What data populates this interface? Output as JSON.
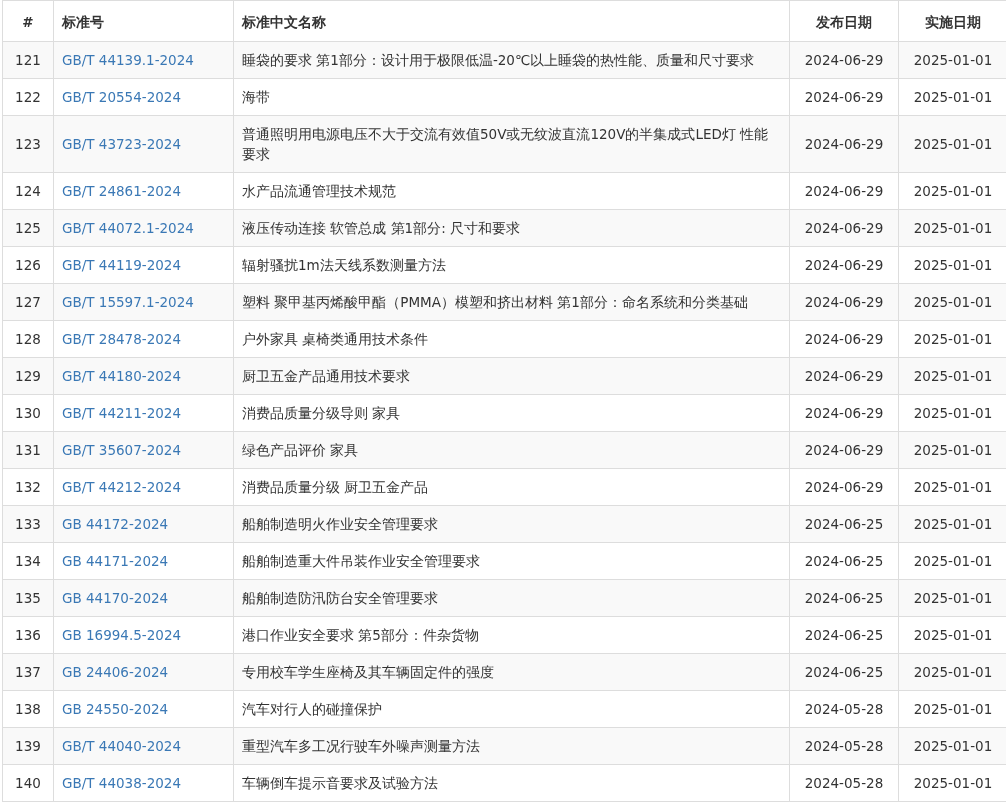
{
  "table": {
    "columns": [
      "#",
      "标准号",
      "标准中文名称",
      "发布日期",
      "实施日期"
    ],
    "rows": [
      {
        "index": "121",
        "code": "GB/T 44139.1-2024",
        "name": "睡袋的要求 第1部分：设计用于极限低温-20℃以上睡袋的热性能、质量和尺寸要求",
        "published": "2024-06-29",
        "effective": "2025-01-01"
      },
      {
        "index": "122",
        "code": "GB/T 20554-2024",
        "name": "海带",
        "published": "2024-06-29",
        "effective": "2025-01-01"
      },
      {
        "index": "123",
        "code": "GB/T 43723-2024",
        "name": "普通照明用电源电压不大于交流有效值50V或无纹波直流120V的半集成式LED灯 性能要求",
        "published": "2024-06-29",
        "effective": "2025-01-01"
      },
      {
        "index": "124",
        "code": "GB/T 24861-2024",
        "name": "水产品流通管理技术规范",
        "published": "2024-06-29",
        "effective": "2025-01-01"
      },
      {
        "index": "125",
        "code": "GB/T 44072.1-2024",
        "name": "液压传动连接 软管总成 第1部分: 尺寸和要求",
        "published": "2024-06-29",
        "effective": "2025-01-01"
      },
      {
        "index": "126",
        "code": "GB/T 44119-2024",
        "name": "辐射骚扰1m法天线系数测量方法",
        "published": "2024-06-29",
        "effective": "2025-01-01"
      },
      {
        "index": "127",
        "code": "GB/T 15597.1-2024",
        "name": "塑料 聚甲基丙烯酸甲酯（PMMA）模塑和挤出材料 第1部分：命名系统和分类基础",
        "published": "2024-06-29",
        "effective": "2025-01-01"
      },
      {
        "index": "128",
        "code": "GB/T 28478-2024",
        "name": "户外家具 桌椅类通用技术条件",
        "published": "2024-06-29",
        "effective": "2025-01-01"
      },
      {
        "index": "129",
        "code": "GB/T 44180-2024",
        "name": "厨卫五金产品通用技术要求",
        "published": "2024-06-29",
        "effective": "2025-01-01"
      },
      {
        "index": "130",
        "code": "GB/T 44211-2024",
        "name": "消费品质量分级导则 家具",
        "published": "2024-06-29",
        "effective": "2025-01-01"
      },
      {
        "index": "131",
        "code": "GB/T 35607-2024",
        "name": "绿色产品评价 家具",
        "published": "2024-06-29",
        "effective": "2025-01-01"
      },
      {
        "index": "132",
        "code": "GB/T 44212-2024",
        "name": "消费品质量分级 厨卫五金产品",
        "published": "2024-06-29",
        "effective": "2025-01-01"
      },
      {
        "index": "133",
        "code": "GB 44172-2024",
        "name": "船舶制造明火作业安全管理要求",
        "published": "2024-06-25",
        "effective": "2025-01-01"
      },
      {
        "index": "134",
        "code": "GB 44171-2024",
        "name": "船舶制造重大件吊装作业安全管理要求",
        "published": "2024-06-25",
        "effective": "2025-01-01"
      },
      {
        "index": "135",
        "code": "GB 44170-2024",
        "name": "船舶制造防汛防台安全管理要求",
        "published": "2024-06-25",
        "effective": "2025-01-01"
      },
      {
        "index": "136",
        "code": "GB 16994.5-2024",
        "name": "港口作业安全要求 第5部分：件杂货物",
        "published": "2024-06-25",
        "effective": "2025-01-01"
      },
      {
        "index": "137",
        "code": "GB 24406-2024",
        "name": "专用校车学生座椅及其车辆固定件的强度",
        "published": "2024-06-25",
        "effective": "2025-01-01"
      },
      {
        "index": "138",
        "code": "GB 24550-2024",
        "name": "汽车对行人的碰撞保护",
        "published": "2024-05-28",
        "effective": "2025-01-01"
      },
      {
        "index": "139",
        "code": "GB/T 44040-2024",
        "name": "重型汽车多工况行驶车外噪声测量方法",
        "published": "2024-05-28",
        "effective": "2025-01-01"
      },
      {
        "index": "140",
        "code": "GB/T 44038-2024",
        "name": "车辆倒车提示音要求及试验方法",
        "published": "2024-05-28",
        "effective": "2025-01-01"
      }
    ]
  }
}
